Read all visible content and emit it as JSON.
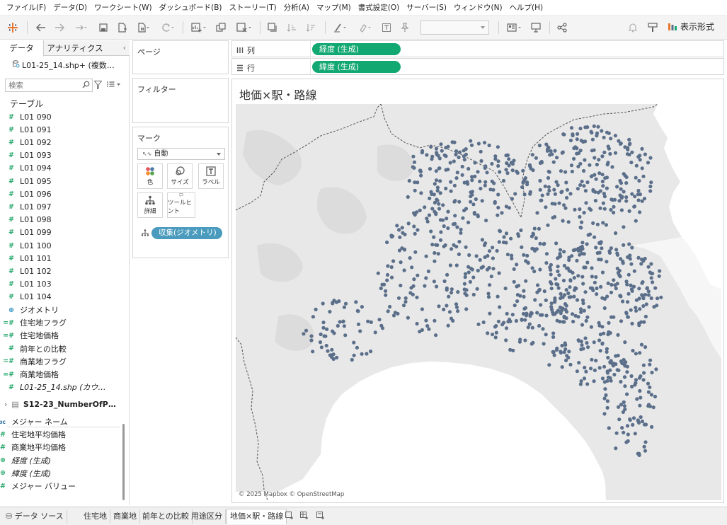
{
  "menu": {
    "items": [
      "ファイル(F)",
      "データ(D)",
      "ワークシート(W)",
      "ダッシュボード(B)",
      "ストーリー(T)",
      "分析(A)",
      "マップ(M)",
      "書式設定(O)",
      "サーバー(S)",
      "ウィンドウ(N)",
      "ヘルプ(H)"
    ]
  },
  "toolbar": {
    "show_me_label": "表示形式",
    "icons": [
      "tableau-logo-icon",
      "undo-icon",
      "redo-icon",
      "replay-icon",
      "save-icon",
      "new-datasource-icon",
      "pause-icon",
      "refresh-icon",
      "new-worksheet-icon",
      "duplicate-icon",
      "clear-sheet-icon",
      "swap-icon",
      "sort-asc-icon",
      "sort-desc-icon",
      "highlight-icon",
      "group-icon",
      "label-icon",
      "pin-icon",
      "fit-icon",
      "presentation-icon",
      "share-icon",
      "bell-icon",
      "paint-icon",
      "show-me-icon"
    ]
  },
  "data_pane": {
    "tab_data": "データ",
    "tab_analytics": "アナリティクス",
    "datasource_name": "L01-25_14.shp+ (複数…",
    "search_placeholder": "検索",
    "table_header": "テーブル",
    "fields": [
      {
        "label": "L01 090",
        "icon": "#",
        "type": "dim",
        "italic": false
      },
      {
        "label": "L01 091",
        "icon": "#",
        "type": "dim",
        "italic": false
      },
      {
        "label": "L01 092",
        "icon": "#",
        "type": "dim",
        "italic": false
      },
      {
        "label": "L01 093",
        "icon": "#",
        "type": "dim",
        "italic": false
      },
      {
        "label": "L01 094",
        "icon": "#",
        "type": "dim",
        "italic": false
      },
      {
        "label": "L01 095",
        "icon": "#",
        "type": "dim",
        "italic": false
      },
      {
        "label": "L01 096",
        "icon": "#",
        "type": "dim",
        "italic": false
      },
      {
        "label": "L01 097",
        "icon": "#",
        "type": "dim",
        "italic": false
      },
      {
        "label": "L01 098",
        "icon": "#",
        "type": "dim",
        "italic": false
      },
      {
        "label": "L01 099",
        "icon": "#",
        "type": "dim",
        "italic": false
      },
      {
        "label": "L01 100",
        "icon": "#",
        "type": "dim",
        "italic": false
      },
      {
        "label": "L01 101",
        "icon": "#",
        "type": "dim",
        "italic": false
      },
      {
        "label": "L01 102",
        "icon": "#",
        "type": "dim",
        "italic": false
      },
      {
        "label": "L01 103",
        "icon": "#",
        "type": "dim",
        "italic": false
      },
      {
        "label": "L01 104",
        "icon": "#",
        "type": "dim",
        "italic": false
      },
      {
        "label": "ジオメトリ",
        "icon": "⊕",
        "type": "globe",
        "italic": false
      },
      {
        "label": "住宅地フラグ",
        "icon": "=#",
        "type": "dim",
        "italic": false
      },
      {
        "label": "住宅地価格",
        "icon": "=#",
        "type": "dim",
        "italic": false
      },
      {
        "label": "前年との比較",
        "icon": "#",
        "type": "dim",
        "italic": false
      },
      {
        "label": "商業地フラグ",
        "icon": "=#",
        "type": "dim",
        "italic": false
      },
      {
        "label": "商業地価格",
        "icon": "=#",
        "type": "dim",
        "italic": false
      },
      {
        "label": "L01-25_14.shp (カウ…",
        "icon": "#",
        "type": "dim",
        "italic": true
      }
    ],
    "second_table": "S12-23_NumberOfP…",
    "measures": [
      {
        "label": "メジャー ネーム",
        "icon": "Abc",
        "type": "abc",
        "italic": false
      },
      {
        "label": "住宅地平均価格",
        "icon": "=#",
        "type": "dim",
        "italic": false
      },
      {
        "label": "商業地平均価格",
        "icon": "=#",
        "type": "dim",
        "italic": false
      },
      {
        "label": "経度 (生成)",
        "icon": "⊕",
        "type": "dim",
        "italic": true
      },
      {
        "label": "緯度 (生成)",
        "icon": "⊕",
        "type": "dim",
        "italic": true
      },
      {
        "label": "メジャー バリュー",
        "icon": "#",
        "type": "dim",
        "italic": false
      }
    ]
  },
  "shelves": {
    "pages_title": "ページ",
    "filters_title": "フィルター",
    "marks_title": "マーク",
    "mark_type": "自動",
    "mark_buttons": [
      "色",
      "サイズ",
      "ラベル",
      "詳細",
      "ツールヒント"
    ],
    "geometry_pill": "収集(ジオメトリ)",
    "columns_label": "列",
    "rows_label": "行",
    "columns_pill": "経度 (生成)",
    "rows_pill": "緯度 (生成)"
  },
  "view": {
    "title": "地価×駅・路線",
    "attribution": "© 2025 Mapbox © OpenStreetMap",
    "point_color": "#5b6f8a"
  },
  "tabs": {
    "datasource": "データ ソース",
    "sheets": [
      "住宅地",
      "商業地",
      "前年との比較",
      "用途区分",
      "地価×駅・路線"
    ],
    "active_index": 4
  },
  "colors": {
    "pill_green": "#12a871",
    "pill_blue": "#4a9bbd",
    "map_land": "#e8e8e8",
    "map_sea": "#ffffff"
  }
}
